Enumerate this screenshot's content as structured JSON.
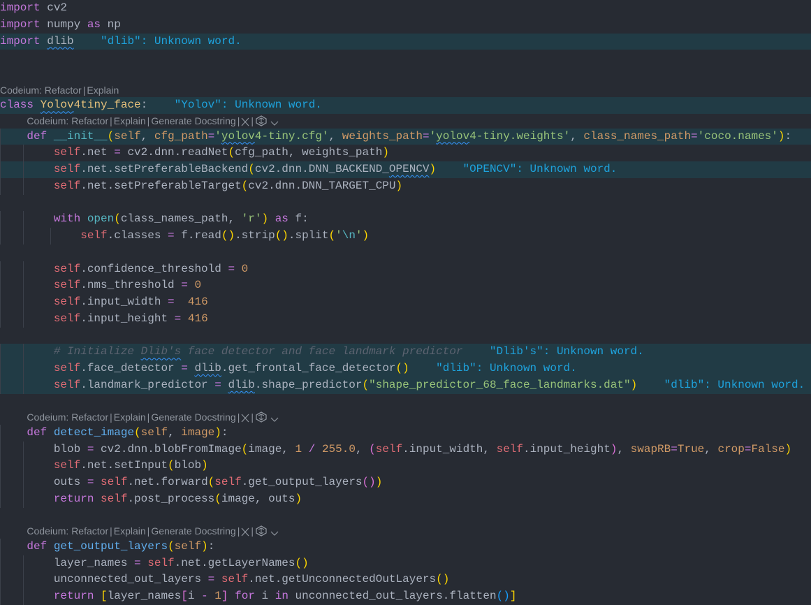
{
  "theme": {
    "background": "#272b33",
    "line_highlight": "#213b45",
    "diagnostic": "#1ea2dc"
  },
  "lens": {
    "short": [
      "Codeium: Refactor",
      "Explain"
    ],
    "full": [
      "Codeium: Refactor",
      "Explain",
      "Generate Docstring"
    ],
    "close_icon": "close-icon",
    "codeium_icon": "codeium-logo-icon",
    "chevron_icon": "chevron-down-icon"
  },
  "lines": [
    {
      "t": "code",
      "tokens": [
        [
          "kw",
          "import"
        ],
        [
          "",
          " cv2"
        ]
      ]
    },
    {
      "t": "code",
      "tokens": [
        [
          "kw",
          "import"
        ],
        [
          "",
          " numpy "
        ],
        [
          "kw",
          "as"
        ],
        [
          "",
          " np"
        ]
      ]
    },
    {
      "t": "code",
      "hl": true,
      "tokens": [
        [
          "kw",
          "import"
        ],
        [
          "",
          " "
        ],
        [
          "",
          "dlib",
          1
        ],
        [
          "diag",
          "    \"dlib\": Unknown word."
        ]
      ]
    },
    {
      "t": "code",
      "tokens": []
    },
    {
      "t": "code",
      "tokens": []
    },
    {
      "t": "lens",
      "indent": 0,
      "kind": "short"
    },
    {
      "t": "code",
      "hl": true,
      "tokens": [
        [
          "kw",
          "class"
        ],
        [
          "",
          " "
        ],
        [
          "cls",
          "Yolov",
          1
        ],
        [
          "cls",
          "4tiny_face"
        ],
        [
          "",
          ":"
        ],
        [
          "diag",
          "    \"Yolov\": Unknown word."
        ]
      ]
    },
    {
      "t": "lens",
      "indent": 4,
      "kind": "full"
    },
    {
      "t": "code",
      "hl": true,
      "tokens": [
        [
          "",
          "    "
        ],
        [
          "kw",
          "def"
        ],
        [
          "",
          " "
        ],
        [
          "bi",
          "__init__"
        ],
        [
          "p1",
          "("
        ],
        [
          "param",
          "self"
        ],
        [
          "",
          ", "
        ],
        [
          "param",
          "cfg_path"
        ],
        [
          "op",
          "="
        ],
        [
          "str",
          "'"
        ],
        [
          "str",
          "yolov",
          1
        ],
        [
          "str",
          "4-tiny.cfg'"
        ],
        [
          "",
          ", "
        ],
        [
          "param",
          "weights_path"
        ],
        [
          "op",
          "="
        ],
        [
          "str",
          "'"
        ],
        [
          "str",
          "yolov",
          1
        ],
        [
          "str",
          "4-tiny.weights'"
        ],
        [
          "",
          ", "
        ],
        [
          "param",
          "class_names_path"
        ],
        [
          "op",
          "="
        ],
        [
          "str",
          "'coco.names'"
        ],
        [
          "p1",
          ")"
        ],
        [
          "",
          ":"
        ]
      ]
    },
    {
      "t": "code",
      "tokens": [
        [
          "",
          "        "
        ],
        [
          "self",
          "self"
        ],
        [
          "",
          ".net "
        ],
        [
          "op",
          "="
        ],
        [
          "",
          " cv2.dnn.readNet"
        ],
        [
          "p1",
          "("
        ],
        [
          "",
          "cfg_path, weights_path"
        ],
        [
          "p1",
          ")"
        ]
      ]
    },
    {
      "t": "code",
      "hl": true,
      "tokens": [
        [
          "",
          "        "
        ],
        [
          "self",
          "self"
        ],
        [
          "",
          ".net.setPreferableBackend"
        ],
        [
          "p1",
          "("
        ],
        [
          "",
          "cv2.dnn.DNN_BACKEND_"
        ],
        [
          "",
          "OPENCV",
          1
        ],
        [
          "p1",
          ")"
        ],
        [
          "diag",
          "    \"OPENCV\": Unknown word."
        ]
      ]
    },
    {
      "t": "code",
      "tokens": [
        [
          "",
          "        "
        ],
        [
          "self",
          "self"
        ],
        [
          "",
          ".net.setPreferableTarget"
        ],
        [
          "p1",
          "("
        ],
        [
          "",
          "cv2.dnn.DNN_TARGET_CPU"
        ],
        [
          "p1",
          ")"
        ]
      ]
    },
    {
      "t": "code",
      "tokens": []
    },
    {
      "t": "code",
      "tokens": [
        [
          "",
          "        "
        ],
        [
          "kw",
          "with"
        ],
        [
          "",
          " "
        ],
        [
          "bi",
          "open"
        ],
        [
          "p1",
          "("
        ],
        [
          "",
          "class_names_path, "
        ],
        [
          "str",
          "'r'"
        ],
        [
          "p1",
          ")"
        ],
        [
          "",
          " "
        ],
        [
          "kw",
          "as"
        ],
        [
          "",
          " f:"
        ]
      ]
    },
    {
      "t": "code",
      "tokens": [
        [
          "",
          "            "
        ],
        [
          "self",
          "self"
        ],
        [
          "",
          ".classes "
        ],
        [
          "op",
          "="
        ],
        [
          "",
          " f.read"
        ],
        [
          "p1",
          "()"
        ],
        [
          "",
          ".strip"
        ],
        [
          "p1",
          "()"
        ],
        [
          "",
          ".split"
        ],
        [
          "p1",
          "("
        ],
        [
          "str",
          "'"
        ],
        [
          "esc",
          "\\n"
        ],
        [
          "str",
          "'"
        ],
        [
          "p1",
          ")"
        ]
      ]
    },
    {
      "t": "code",
      "tokens": []
    },
    {
      "t": "code",
      "tokens": [
        [
          "",
          "        "
        ],
        [
          "self",
          "self"
        ],
        [
          "",
          ".confidence_threshold "
        ],
        [
          "op",
          "="
        ],
        [
          "",
          " "
        ],
        [
          "num",
          "0"
        ]
      ]
    },
    {
      "t": "code",
      "tokens": [
        [
          "",
          "        "
        ],
        [
          "self",
          "self"
        ],
        [
          "",
          ".nms_threshold "
        ],
        [
          "op",
          "="
        ],
        [
          "",
          " "
        ],
        [
          "num",
          "0"
        ]
      ]
    },
    {
      "t": "code",
      "tokens": [
        [
          "",
          "        "
        ],
        [
          "self",
          "self"
        ],
        [
          "",
          ".input_width "
        ],
        [
          "op",
          "="
        ],
        [
          "",
          "  "
        ],
        [
          "num",
          "416"
        ]
      ]
    },
    {
      "t": "code",
      "tokens": [
        [
          "",
          "        "
        ],
        [
          "self",
          "self"
        ],
        [
          "",
          ".input_height "
        ],
        [
          "op",
          "="
        ],
        [
          "",
          " "
        ],
        [
          "num",
          "416"
        ]
      ]
    },
    {
      "t": "code",
      "tokens": []
    },
    {
      "t": "code",
      "hl": true,
      "tokens": [
        [
          "",
          "        "
        ],
        [
          "cm",
          "# Initialize "
        ],
        [
          "cm",
          "Dlib's",
          1
        ],
        [
          "cm",
          " face detector and face landmark predictor"
        ],
        [
          "diag",
          "    \"Dlib's\": Unknown word."
        ]
      ]
    },
    {
      "t": "code",
      "hl": true,
      "tokens": [
        [
          "",
          "        "
        ],
        [
          "self",
          "self"
        ],
        [
          "",
          ".face_detector "
        ],
        [
          "op",
          "="
        ],
        [
          "",
          " "
        ],
        [
          "",
          "dlib",
          1
        ],
        [
          "",
          ".get_frontal_face_detector"
        ],
        [
          "p1",
          "()"
        ],
        [
          "diag",
          "    \"dlib\": Unknown word."
        ]
      ]
    },
    {
      "t": "code",
      "hl": true,
      "tokens": [
        [
          "",
          "        "
        ],
        [
          "self",
          "self"
        ],
        [
          "",
          ".landmark_predictor "
        ],
        [
          "op",
          "="
        ],
        [
          "",
          " "
        ],
        [
          "",
          "dlib",
          1
        ],
        [
          "",
          ".shape_predictor"
        ],
        [
          "p1",
          "("
        ],
        [
          "str",
          "\"shape_predictor_68_face_landmarks.dat\""
        ],
        [
          "p1",
          ")"
        ],
        [
          "diag",
          "    \"dlib\": Unknown word."
        ]
      ]
    },
    {
      "t": "code",
      "tokens": []
    },
    {
      "t": "lens",
      "indent": 4,
      "kind": "full"
    },
    {
      "t": "code",
      "tokens": [
        [
          "",
          "    "
        ],
        [
          "kw",
          "def"
        ],
        [
          "",
          " "
        ],
        [
          "fn",
          "detect_image"
        ],
        [
          "p1",
          "("
        ],
        [
          "param",
          "self"
        ],
        [
          "",
          ", "
        ],
        [
          "param",
          "image"
        ],
        [
          "p1",
          ")"
        ],
        [
          "",
          ":"
        ]
      ]
    },
    {
      "t": "code",
      "tokens": [
        [
          "",
          "        blob "
        ],
        [
          "op",
          "="
        ],
        [
          "",
          " cv2.dnn.blobFromImage"
        ],
        [
          "p1",
          "("
        ],
        [
          "",
          "image, "
        ],
        [
          "num",
          "1"
        ],
        [
          "",
          " "
        ],
        [
          "op",
          "/"
        ],
        [
          "",
          " "
        ],
        [
          "num",
          "255.0"
        ],
        [
          "",
          ", "
        ],
        [
          "p2",
          "("
        ],
        [
          "self",
          "self"
        ],
        [
          "",
          ".input_width, "
        ],
        [
          "self",
          "self"
        ],
        [
          "",
          ".input_height"
        ],
        [
          "p2",
          ")"
        ],
        [
          "",
          ", "
        ],
        [
          "param",
          "swapRB"
        ],
        [
          "op",
          "="
        ],
        [
          "num",
          "True"
        ],
        [
          "",
          ", "
        ],
        [
          "param",
          "crop"
        ],
        [
          "op",
          "="
        ],
        [
          "num",
          "False"
        ],
        [
          "p1",
          ")"
        ]
      ]
    },
    {
      "t": "code",
      "tokens": [
        [
          "",
          "        "
        ],
        [
          "self",
          "self"
        ],
        [
          "",
          ".net.setInput"
        ],
        [
          "p1",
          "("
        ],
        [
          "",
          "blob"
        ],
        [
          "p1",
          ")"
        ]
      ]
    },
    {
      "t": "code",
      "tokens": [
        [
          "",
          "        outs "
        ],
        [
          "op",
          "="
        ],
        [
          "",
          " "
        ],
        [
          "self",
          "self"
        ],
        [
          "",
          ".net.forward"
        ],
        [
          "p1",
          "("
        ],
        [
          "self",
          "self"
        ],
        [
          "",
          ".get_output_layers"
        ],
        [
          "p2",
          "()"
        ],
        [
          "p1",
          ")"
        ]
      ]
    },
    {
      "t": "code",
      "tokens": [
        [
          "",
          "        "
        ],
        [
          "kw",
          "return"
        ],
        [
          "",
          " "
        ],
        [
          "self",
          "self"
        ],
        [
          "",
          ".post_process"
        ],
        [
          "p1",
          "("
        ],
        [
          "",
          "image, outs"
        ],
        [
          "p1",
          ")"
        ]
      ]
    },
    {
      "t": "code",
      "tokens": []
    },
    {
      "t": "lens",
      "indent": 4,
      "kind": "full"
    },
    {
      "t": "code",
      "tokens": [
        [
          "",
          "    "
        ],
        [
          "kw",
          "def"
        ],
        [
          "",
          " "
        ],
        [
          "fn",
          "get_output_layers"
        ],
        [
          "p1",
          "("
        ],
        [
          "param",
          "self"
        ],
        [
          "p1",
          ")"
        ],
        [
          "",
          ":"
        ]
      ]
    },
    {
      "t": "code",
      "tokens": [
        [
          "",
          "        layer_names "
        ],
        [
          "op",
          "="
        ],
        [
          "",
          " "
        ],
        [
          "self",
          "self"
        ],
        [
          "",
          ".net.getLayerNames"
        ],
        [
          "p1",
          "()"
        ]
      ]
    },
    {
      "t": "code",
      "tokens": [
        [
          "",
          "        unconnected_out_layers "
        ],
        [
          "op",
          "="
        ],
        [
          "",
          " "
        ],
        [
          "self",
          "self"
        ],
        [
          "",
          ".net.getUnconnectedOutLayers"
        ],
        [
          "p1",
          "()"
        ]
      ]
    },
    {
      "t": "code",
      "tokens": [
        [
          "",
          "        "
        ],
        [
          "kw",
          "return"
        ],
        [
          "",
          " "
        ],
        [
          "p1",
          "["
        ],
        [
          "",
          "layer_names"
        ],
        [
          "p2",
          "["
        ],
        [
          "",
          "i "
        ],
        [
          "op",
          "-"
        ],
        [
          "",
          " "
        ],
        [
          "num",
          "1"
        ],
        [
          "p2",
          "]"
        ],
        [
          "",
          " "
        ],
        [
          "kw",
          "for"
        ],
        [
          "",
          " i "
        ],
        [
          "kw",
          "in"
        ],
        [
          "",
          " unconnected_out_layers.flatten"
        ],
        [
          "p3",
          "()"
        ],
        [
          "p1",
          "]"
        ]
      ]
    }
  ]
}
